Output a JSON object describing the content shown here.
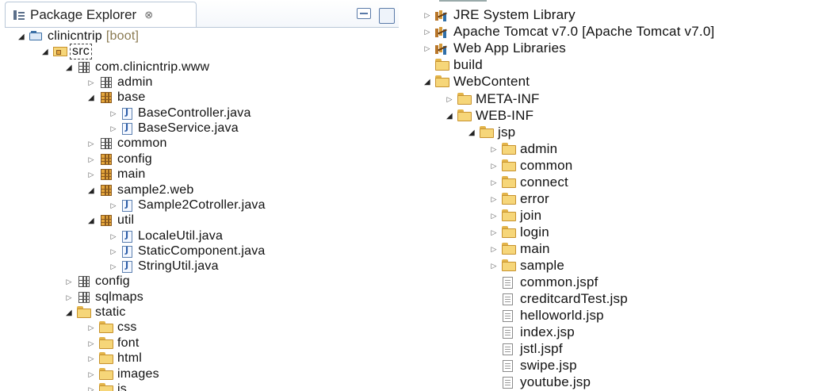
{
  "left_panel": {
    "tab": {
      "title": "Package Explorer",
      "close": "⊗"
    },
    "tree": [
      {
        "label": "clinicntrip",
        "decoration": "[boot]",
        "icon": "project-icon",
        "state": "expanded"
      },
      {
        "label": "src",
        "icon": "source-folder-icon",
        "state": "expanded",
        "selected": true
      },
      {
        "label": "com.clinicntrip.www",
        "icon": "package-icon",
        "state": "expanded"
      },
      {
        "label": "admin",
        "icon": "package-icon",
        "state": "collapsed"
      },
      {
        "label": "base",
        "icon": "package-filled-icon",
        "state": "expanded"
      },
      {
        "label": "BaseController.java",
        "icon": "java-file-icon",
        "state": "collapsed"
      },
      {
        "label": "BaseService.java",
        "icon": "java-file-icon",
        "state": "collapsed"
      },
      {
        "label": "common",
        "icon": "package-icon",
        "state": "collapsed"
      },
      {
        "label": "config",
        "icon": "package-filled-icon",
        "state": "collapsed"
      },
      {
        "label": "main",
        "icon": "package-filled-icon",
        "state": "collapsed"
      },
      {
        "label": "sample2.web",
        "icon": "package-filled-icon",
        "state": "expanded"
      },
      {
        "label": "Sample2Cotroller.java",
        "icon": "java-file-icon",
        "state": "collapsed"
      },
      {
        "label": "util",
        "icon": "package-filled-icon",
        "state": "expanded"
      },
      {
        "label": "LocaleUtil.java",
        "icon": "java-file-icon",
        "state": "collapsed"
      },
      {
        "label": "StaticComponent.java",
        "icon": "java-file-icon",
        "state": "collapsed"
      },
      {
        "label": "StringUtil.java",
        "icon": "java-file-icon",
        "state": "collapsed"
      },
      {
        "label": "config",
        "icon": "package-icon",
        "state": "collapsed"
      },
      {
        "label": "sqlmaps",
        "icon": "package-icon",
        "state": "collapsed"
      },
      {
        "label": "static",
        "icon": "folder-icon",
        "state": "expanded"
      },
      {
        "label": "css",
        "icon": "folder-icon",
        "state": "collapsed"
      },
      {
        "label": "font",
        "icon": "folder-icon",
        "state": "collapsed"
      },
      {
        "label": "html",
        "icon": "folder-icon",
        "state": "collapsed"
      },
      {
        "label": "images",
        "icon": "folder-icon",
        "state": "collapsed"
      },
      {
        "label": "js",
        "icon": "folder-icon",
        "state": "collapsed"
      }
    ]
  },
  "right_panel": {
    "tree": [
      {
        "label": "JRE System Library",
        "icon": "library-icon",
        "state": "collapsed"
      },
      {
        "label": "Apache Tomcat v7.0 [Apache Tomcat v7.0]",
        "icon": "library-icon",
        "state": "collapsed"
      },
      {
        "label": "Web App Libraries",
        "icon": "library-icon",
        "state": "collapsed"
      },
      {
        "label": "build",
        "icon": "folder-icon",
        "state": "none"
      },
      {
        "label": "WebContent",
        "icon": "folder-icon",
        "state": "expanded"
      },
      {
        "label": "META-INF",
        "icon": "folder-icon",
        "state": "collapsed"
      },
      {
        "label": "WEB-INF",
        "icon": "folder-icon",
        "state": "expanded"
      },
      {
        "label": "jsp",
        "icon": "folder-icon",
        "state": "expanded"
      },
      {
        "label": "admin",
        "icon": "folder-icon",
        "state": "collapsed"
      },
      {
        "label": "common",
        "icon": "folder-icon",
        "state": "collapsed"
      },
      {
        "label": "connect",
        "icon": "folder-icon",
        "state": "collapsed"
      },
      {
        "label": "error",
        "icon": "folder-icon",
        "state": "collapsed"
      },
      {
        "label": "join",
        "icon": "folder-icon",
        "state": "collapsed"
      },
      {
        "label": "login",
        "icon": "folder-icon",
        "state": "collapsed"
      },
      {
        "label": "main",
        "icon": "folder-icon",
        "state": "collapsed"
      },
      {
        "label": "sample",
        "icon": "folder-icon",
        "state": "collapsed"
      },
      {
        "label": "common.jspf",
        "icon": "jsp-file-icon",
        "state": "none"
      },
      {
        "label": "creditcardTest.jsp",
        "icon": "jsp-file-icon",
        "state": "none"
      },
      {
        "label": "helloworld.jsp",
        "icon": "jsp-file-icon",
        "state": "none"
      },
      {
        "label": "index.jsp",
        "icon": "jsp-file-icon",
        "state": "none"
      },
      {
        "label": "jstl.jspf",
        "icon": "jsp-file-icon",
        "state": "none"
      },
      {
        "label": "swipe.jsp",
        "icon": "jsp-file-icon",
        "state": "none"
      },
      {
        "label": "youtube.jsp",
        "icon": "jsp-file-icon",
        "state": "none"
      }
    ]
  }
}
